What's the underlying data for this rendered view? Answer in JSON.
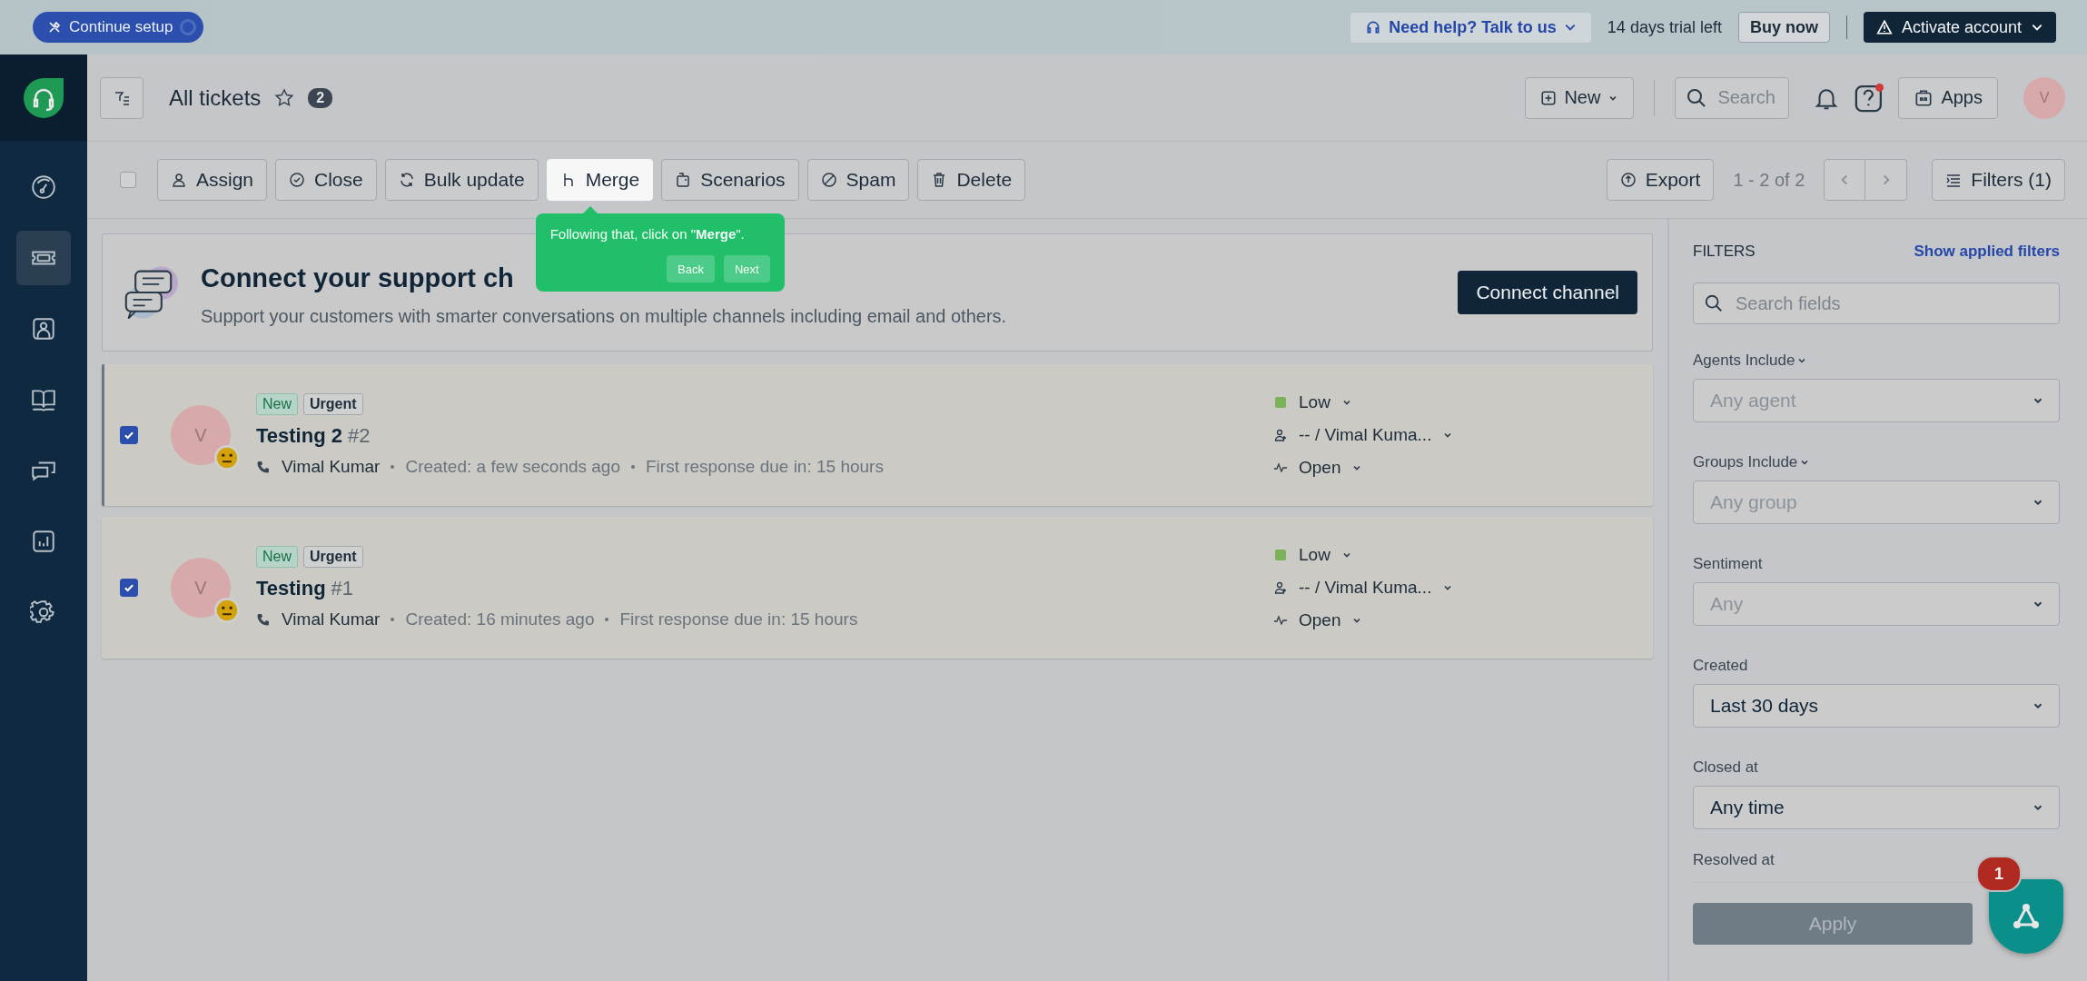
{
  "top_bar": {
    "setup_button": "Continue setup",
    "help_link": "Need help? Talk to us",
    "trial": "14 days trial left",
    "buy_button": "Buy now",
    "activate_button": "Activate account"
  },
  "header": {
    "title": "All tickets",
    "count": "2",
    "new_button": "New",
    "search_placeholder": "Search",
    "apps_button": "Apps",
    "avatar": "V",
    "help_notification": true
  },
  "sidebar": {
    "items": [
      {
        "kind": "dashboard",
        "selected": false
      },
      {
        "kind": "tickets",
        "selected": true
      },
      {
        "kind": "contacts",
        "selected": false
      },
      {
        "kind": "knowledge",
        "selected": false
      },
      {
        "kind": "conversations",
        "selected": false
      },
      {
        "kind": "reports",
        "selected": false
      },
      {
        "kind": "settings",
        "selected": false
      }
    ]
  },
  "toolbar": {
    "select_all": false,
    "actions": [
      {
        "kind": "assign",
        "label": "Assign",
        "selected": false
      },
      {
        "kind": "close",
        "label": "Close",
        "selected": false
      },
      {
        "kind": "bulk",
        "label": "Bulk update",
        "selected": false
      },
      {
        "kind": "merge",
        "label": "Merge",
        "selected": true
      },
      {
        "kind": "scenarios",
        "label": "Scenarios",
        "selected": false
      },
      {
        "kind": "spam",
        "label": "Spam",
        "selected": false
      },
      {
        "kind": "delete",
        "label": "Delete",
        "selected": false
      }
    ],
    "export": "Export",
    "range": "1 - 2 of 2",
    "filters": "Filters (1)"
  },
  "tooltip": {
    "text": "Following that, click on \"**Merge**\".",
    "buttons": [
      "Back",
      "Next"
    ]
  },
  "banner": {
    "title": "Connect your support ch",
    "subtitle": "Support your customers with smarter conversations on multiple channels including email and others.",
    "button": "Connect channel"
  },
  "tickets": [
    {
      "checked": true,
      "avatar": "V",
      "tags": [
        {
          "label": "New",
          "kind": "status"
        },
        {
          "label": "Urgent",
          "kind": "priority"
        }
      ],
      "title": "Testing 2",
      "number": "#2",
      "requester": "Vimal Kumar",
      "created": "Created: a few seconds ago",
      "due": "First response due in: 15 hours",
      "priority": "Low",
      "color": "#7cb15a",
      "assignee": "-- / Vimal Kuma...",
      "status": "Open"
    },
    {
      "checked": true,
      "avatar": "V",
      "tags": [
        {
          "label": "New",
          "kind": "status"
        },
        {
          "label": "Urgent",
          "kind": "priority"
        }
      ],
      "title": "Testing",
      "number": "#1",
      "requester": "Vimal Kumar",
      "created": "Created: 16 minutes ago",
      "due": "First response due in: 15 hours",
      "priority": "Low",
      "color": "#7cb15a",
      "assignee": "-- / Vimal Kuma...",
      "status": "Open"
    }
  ],
  "filters": {
    "heading": "FILTERS",
    "link": "Show applied filters",
    "search_placeholder": "Search fields",
    "fields": [
      {
        "label": "Agents Include",
        "kind": "menu",
        "placeholder": "Any agent"
      },
      {
        "label": "Groups Include",
        "kind": "menu",
        "placeholder": "Any group"
      },
      {
        "label": "Sentiment",
        "kind": "plain",
        "placeholder": "Any"
      },
      {
        "label": "Created",
        "kind": "plain",
        "value": "Last 30 days"
      },
      {
        "label": "Closed at",
        "kind": "plain",
        "value": "Any time"
      }
    ],
    "last_label": "Resolved at",
    "apply_button": "Apply"
  },
  "chat_widget": {
    "badge": "1"
  }
}
